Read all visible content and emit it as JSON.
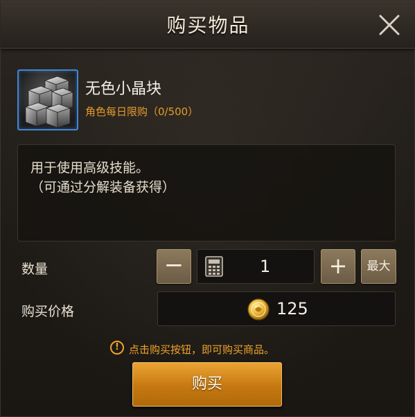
{
  "dialog": {
    "title": "购买物品",
    "close_icon": "close-icon"
  },
  "item": {
    "name": "无色小晶块",
    "limit": "角色每日限购（0/500）",
    "icon": "crystal-cube-icon",
    "icon_border_color": "#3f86d8"
  },
  "description": {
    "line1": "用于使用高级技能。",
    "line2": "（可通过分解装备获得）"
  },
  "quantity": {
    "label": "数量",
    "minus": "−",
    "plus": "+",
    "value": "1",
    "max_label": "最大",
    "calculator_icon": "calculator-icon"
  },
  "price": {
    "label": "购买价格",
    "value": "125",
    "currency_icon": "gold-coin-icon"
  },
  "notice": {
    "icon": "!",
    "text": "点击购买按钮，即可购买商品。"
  },
  "buy_button": {
    "label": "购买"
  },
  "colors": {
    "accent_orange": "#e79b2a",
    "buy_button": "#d88a1e"
  }
}
